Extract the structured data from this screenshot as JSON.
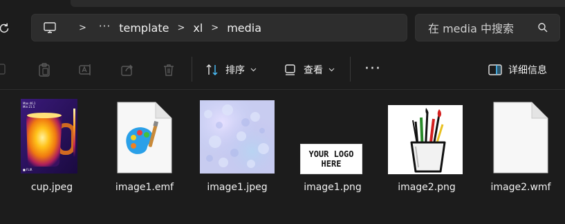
{
  "address": {
    "more": "···",
    "crumbs": [
      "template",
      "xl",
      "media"
    ]
  },
  "search": {
    "placeholder": "在 media 中搜索"
  },
  "toolbar": {
    "sort_label": "排序",
    "view_label": "查看",
    "more_label": "···",
    "details_label": "详细信息"
  },
  "files": [
    {
      "name": "cup.jpeg",
      "kind": "thermal-image"
    },
    {
      "name": "image1.emf",
      "kind": "document-palette-icon"
    },
    {
      "name": "image1.jpeg",
      "kind": "texture-image"
    },
    {
      "name": "image1.png",
      "kind": "logo-image",
      "logo_line1": "YOUR LOGO",
      "logo_line2": "HERE"
    },
    {
      "name": "image2.png",
      "kind": "art-supplies-image"
    },
    {
      "name": "image2.wmf",
      "kind": "blank-document-icon"
    }
  ],
  "colors": {
    "background": "#1c1c1c",
    "field": "#2d2d2d",
    "accent": "#4cc2ff",
    "text": "#f2f2f2"
  }
}
